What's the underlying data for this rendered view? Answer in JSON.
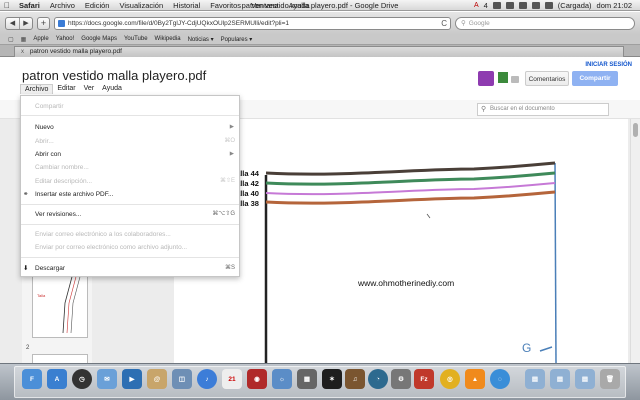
{
  "menubar": {
    "app": "Safari",
    "items": [
      "Archivo",
      "Edición",
      "Visualización",
      "Historial",
      "Favoritos",
      "Ventana",
      "Ayuda"
    ],
    "window_title": "patron vestido malla playero.pdf - Google Drive",
    "status": {
      "four": "4",
      "battery": "(Cargada)",
      "clock": "dom 21:02"
    }
  },
  "toolbar": {
    "back": "◀",
    "forward": "▶",
    "add": "+",
    "url": "https://docs.google.com/file/d/0By2TglJY-CdjUQkxOUlp2SERMUlli/edit?pli=1",
    "reload": "C",
    "search_placeholder": "Google"
  },
  "bookmarks": [
    "Apple",
    "Yahoo!",
    "Google Maps",
    "YouTube",
    "Wikipedia",
    "Noticias ▾",
    "Populares ▾"
  ],
  "tab": {
    "label": "patron vestido malla playero.pdf",
    "close": "x"
  },
  "doc": {
    "title": "patron vestido malla playero.pdf",
    "menu": [
      "Archivo",
      "Editar",
      "Ver",
      "Ayuda"
    ],
    "signin": "INICIAR SESIÓN",
    "comment_button": "Comentarios",
    "share_button": "Compartir",
    "search_placeholder": "Buscar en el documento"
  },
  "file_menu": [
    {
      "label": "Compartir",
      "disabled": true
    },
    {
      "label": "Nuevo",
      "submenu": true
    },
    {
      "label": "Abrir...",
      "shortcut": "⌘O",
      "disabled": true
    },
    {
      "label": "Abrir con",
      "submenu": true
    },
    {
      "label": "Cambiar nombre...",
      "disabled": true
    },
    {
      "label": "Editar descripción...",
      "shortcut": "⌘⇧E",
      "disabled": true
    },
    {
      "label": "Insertar este archivo PDF..."
    },
    {
      "label": "Ver revisiones...",
      "shortcut": "⌘⌥⇧G"
    },
    {
      "label": "Enviar correo electrónico a los colaboradores...",
      "disabled": true
    },
    {
      "label": "Enviar por correo electrónico como archivo adjunto...",
      "disabled": true
    },
    {
      "label": "Descargar",
      "shortcut": "⌘S"
    }
  ],
  "pdf": {
    "site": "www.ohmotherinediy.com",
    "tallas": [
      "Talla 44",
      "Talla 42",
      "Talla 40",
      "Talla 38"
    ],
    "page_number": "2",
    "corner_mark": "G"
  },
  "dock_icons": [
    "Finder",
    "App Store",
    "Dashboard",
    "Mail",
    "FaceTime",
    "Contactos",
    "Preview",
    "iTunes",
    "iCal",
    "Photo Booth",
    "iPhoto",
    "Mission Control",
    "GarageBand",
    "Time Machine",
    "Preferencias",
    "FileZilla",
    "Chrome",
    "VLC",
    "iChat",
    "Descargas",
    "Documentos",
    "Papelera"
  ],
  "colors": {
    "share": "#8fb2f2",
    "link": "#1155cc",
    "line_44": "#4a3f38",
    "line_42": "#3f8a5a",
    "line_40": "#c679d6",
    "line_38": "#b5653b"
  }
}
